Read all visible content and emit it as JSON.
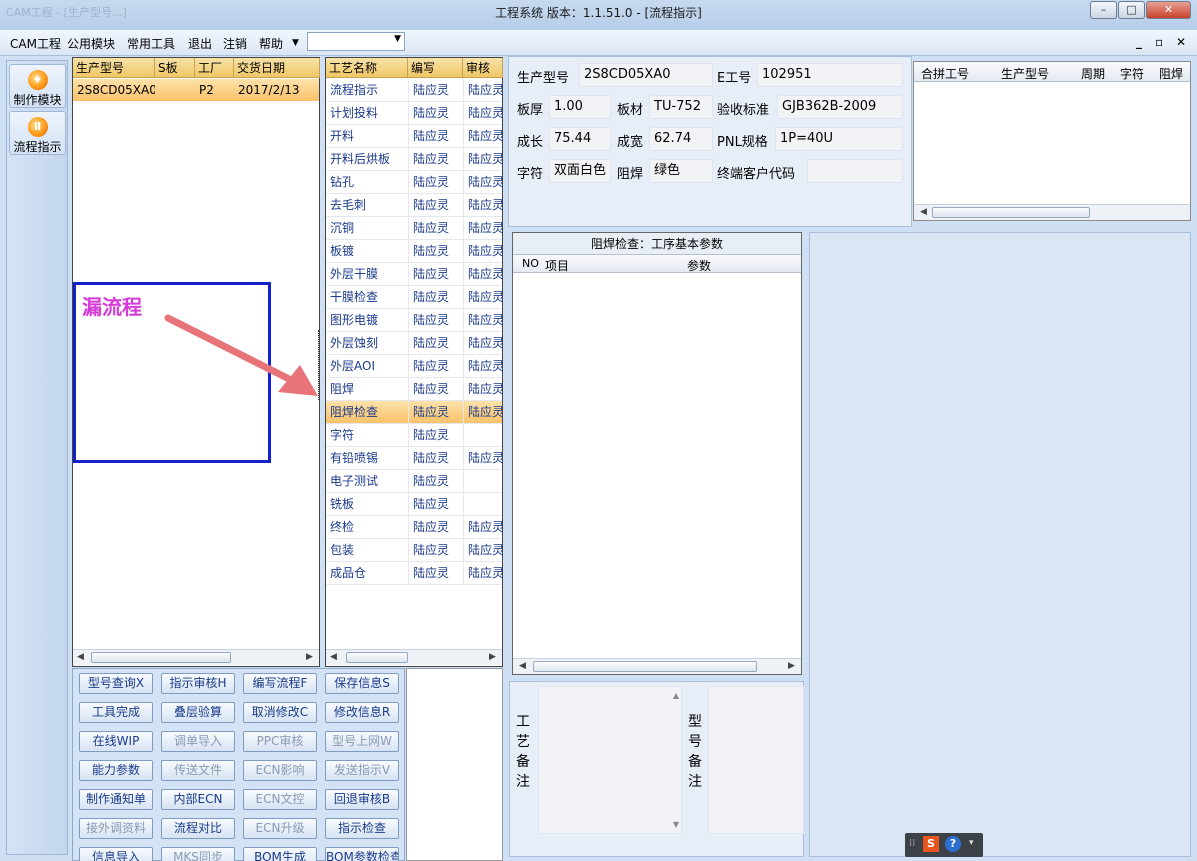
{
  "window": {
    "title": "工程系统  版本：1.1.51.0 - [流程指示]",
    "ghost_title": "CAM工程 - [生产型号...]"
  },
  "menu": [
    "CAM工程",
    "公用模块",
    "常用工具",
    "退出",
    "注销",
    "帮助"
  ],
  "sidebar": [
    {
      "label": "制作模块"
    },
    {
      "label": "流程指示"
    }
  ],
  "orders": {
    "columns": [
      "生产型号",
      "S板",
      "工厂",
      "交货日期"
    ],
    "rows": [
      {
        "model": "2S8CD05XA0",
        "s": "",
        "factory": "P2",
        "date": "2017/2/13"
      }
    ]
  },
  "process": {
    "columns": [
      "工艺名称",
      "编写",
      "审核"
    ],
    "rows": [
      {
        "name": "流程指示",
        "writer": "陆应灵",
        "reviewer": "陆应灵"
      },
      {
        "name": "计划投料",
        "writer": "陆应灵",
        "reviewer": "陆应灵"
      },
      {
        "name": "开料",
        "writer": "陆应灵",
        "reviewer": "陆应灵"
      },
      {
        "name": "开料后烘板",
        "writer": "陆应灵",
        "reviewer": "陆应灵"
      },
      {
        "name": "钻孔",
        "writer": "陆应灵",
        "reviewer": "陆应灵"
      },
      {
        "name": "去毛刺",
        "writer": "陆应灵",
        "reviewer": "陆应灵"
      },
      {
        "name": "沉铜",
        "writer": "陆应灵",
        "reviewer": "陆应灵"
      },
      {
        "name": "板镀",
        "writer": "陆应灵",
        "reviewer": "陆应灵"
      },
      {
        "name": "外层干膜",
        "writer": "陆应灵",
        "reviewer": "陆应灵"
      },
      {
        "name": "干膜检查",
        "writer": "陆应灵",
        "reviewer": "陆应灵"
      },
      {
        "name": "图形电镀",
        "writer": "陆应灵",
        "reviewer": "陆应灵"
      },
      {
        "name": "外层蚀刻",
        "writer": "陆应灵",
        "reviewer": "陆应灵"
      },
      {
        "name": "外层AOI",
        "writer": "陆应灵",
        "reviewer": "陆应灵"
      },
      {
        "name": "阻焊",
        "writer": "陆应灵",
        "reviewer": "陆应灵"
      },
      {
        "name": "阻焊检查",
        "writer": "陆应灵",
        "reviewer": "陆应灵",
        "selected": true
      },
      {
        "name": "字符",
        "writer": "陆应灵",
        "reviewer": ""
      },
      {
        "name": "有铅喷锡",
        "writer": "陆应灵",
        "reviewer": "陆应灵"
      },
      {
        "name": "电子测试",
        "writer": "陆应灵",
        "reviewer": ""
      },
      {
        "name": "铣板",
        "writer": "陆应灵",
        "reviewer": ""
      },
      {
        "name": "终检",
        "writer": "陆应灵",
        "reviewer": "陆应灵"
      },
      {
        "name": "包装",
        "writer": "陆应灵",
        "reviewer": "陆应灵"
      },
      {
        "name": "成品仓",
        "writer": "陆应灵",
        "reviewer": "陆应灵"
      }
    ]
  },
  "info": {
    "model_label": "生产型号",
    "model": "2S8CD05XA0",
    "e_label": "E工号",
    "e": "102951",
    "thick_label": "板厚",
    "thick": "1.00",
    "mat_label": "板材",
    "mat": "TU-752",
    "std_label": "验收标准",
    "std": "GJB362B-2009",
    "len_label": "成长",
    "len": "75.44",
    "wid_label": "成宽",
    "wid": "62.74",
    "pnl_label": "PNL规格",
    "pnl": "1P=40U",
    "char_label": "字符",
    "char": "双面白色",
    "mask_label": "阻焊",
    "mask": "绿色",
    "cust_label": "终端客户代码",
    "cust": ""
  },
  "merge": {
    "columns": [
      "合拼工号",
      "生产型号",
      "周期",
      "字符",
      "阻焊"
    ]
  },
  "params": {
    "title": "阻焊检查：工序基本参数",
    "columns": [
      "NO",
      "项目",
      "参数"
    ]
  },
  "notes": {
    "process_label": "工艺备注",
    "model_label": "型号备注"
  },
  "buttons": [
    {
      "label": "型号查询X",
      "enabled": true
    },
    {
      "label": "指示审核H",
      "enabled": true
    },
    {
      "label": "编写流程F",
      "enabled": true
    },
    {
      "label": "保存信息S",
      "enabled": true
    },
    {
      "label": "工具完成",
      "enabled": true
    },
    {
      "label": "叠层验算",
      "enabled": true
    },
    {
      "label": "取消修改C",
      "enabled": true
    },
    {
      "label": "修改信息R",
      "enabled": true
    },
    {
      "label": "在线WIP",
      "enabled": true
    },
    {
      "label": "调单导入",
      "enabled": false
    },
    {
      "label": "PPC审核",
      "enabled": false
    },
    {
      "label": "型号上网W",
      "enabled": false
    },
    {
      "label": "能力参数",
      "enabled": true
    },
    {
      "label": "传送文件",
      "enabled": false
    },
    {
      "label": "ECN影响",
      "enabled": false
    },
    {
      "label": "发送指示V",
      "enabled": false
    },
    {
      "label": "制作通知单",
      "enabled": true
    },
    {
      "label": "内部ECN",
      "enabled": true
    },
    {
      "label": "ECN文控",
      "enabled": false
    },
    {
      "label": "回退审核B",
      "enabled": true
    },
    {
      "label": "接外调资料",
      "enabled": false
    },
    {
      "label": "流程对比",
      "enabled": true
    },
    {
      "label": "ECN升级",
      "enabled": false
    },
    {
      "label": "指示检查",
      "enabled": true
    },
    {
      "label": "信息导入",
      "enabled": true
    },
    {
      "label": "MKS同步",
      "enabled": false
    },
    {
      "label": "BOM生成",
      "enabled": true
    },
    {
      "label": "BOM参数检查",
      "enabled": true
    }
  ],
  "annotation": {
    "text": "漏流程"
  },
  "colors": {
    "annotation_border": "#1420c8",
    "annotation_text": "#d63ad6",
    "arrow": "#e8747a",
    "selected_row": "#f9c26a"
  }
}
